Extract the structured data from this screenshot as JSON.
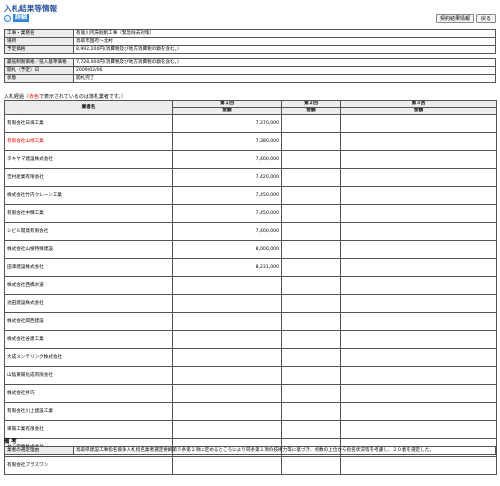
{
  "header": {
    "title": "入札結果等情報",
    "section_label": "詳細",
    "buttons": {
      "contract_result": "契約結果情報",
      "back": "戻る"
    }
  },
  "info": [
    {
      "label": "工事・業務名",
      "value": "有富川河床掘削工事（緊急除去対策）"
    },
    {
      "label": "場所",
      "value": "鳥取市国府～北村"
    },
    {
      "label": "予定価格",
      "value": "8,992,200円(消費税及び地方消費税の額を含む。)"
    },
    {
      "label": "最低制限価格／低入基準価格",
      "value": "7,728,000円(消費税及び地方消費税の額を含む。)"
    },
    {
      "label": "開札（予定）日",
      "value": "2009/02/06"
    },
    {
      "label": "状態",
      "value": "開札完了"
    }
  ],
  "bid_table": {
    "caption_prefix": "入札経過（",
    "caption_red": "赤色",
    "caption_suffix": "で表示されているのは落札業者です。）",
    "headers": {
      "company": "業者名",
      "round1": "第１回",
      "round2": "第２回",
      "round3": "第３回",
      "amount": "金額",
      "remarks": "摘要"
    },
    "rows": [
      {
        "company": "有限会社日海工業",
        "amount": "7,270,000",
        "remark": "失格（無効）　最低制限価格を下回ったため",
        "winner": false
      },
      {
        "company": "有限会社山崎工業",
        "amount": "7,380,000",
        "remark": "落札",
        "winner": true
      },
      {
        "company": "タキヤマ建設株式会社",
        "amount": "7,400,000",
        "remark": "",
        "winner": false
      },
      {
        "company": "吉村産業有限会社",
        "amount": "7,420,000",
        "remark": "",
        "winner": false
      },
      {
        "company": "株式会社竹内クレーン工業",
        "amount": "7,450,000",
        "remark": "",
        "winner": false
      },
      {
        "company": "有限会社中輝工業",
        "amount": "7,450,000",
        "remark": "",
        "winner": false
      },
      {
        "company": "シビル開発有限会社",
        "amount": "7,400,000",
        "remark": "",
        "winner": false
      },
      {
        "company": "株式会社山根特殊建設",
        "amount": "8,000,000",
        "remark": "",
        "winner": false
      },
      {
        "company": "田澤建設株式会社",
        "amount": "8,231,000",
        "remark": "",
        "winner": false
      },
      {
        "company": "株式会社西橋水道",
        "amount": "",
        "remark": "辞退",
        "winner": false
      },
      {
        "company": "池田建設株式会社",
        "amount": "",
        "remark": "欠席",
        "winner": false
      },
      {
        "company": "株式会社関西建設",
        "amount": "",
        "remark": "辞退",
        "winner": false
      },
      {
        "company": "株式会社谷建工業",
        "amount": "",
        "remark": "辞退",
        "winner": false
      },
      {
        "company": "大成メンテリング株式会社",
        "amount": "",
        "remark": "辞退",
        "winner": false
      },
      {
        "company": "山陰東陽化成有限会社",
        "amount": "",
        "remark": "辞退",
        "winner": false
      },
      {
        "company": "株式会社井巧",
        "amount": "",
        "remark": "辞退",
        "winner": false
      },
      {
        "company": "有限会社川上建設工業",
        "amount": "",
        "remark": "辞退",
        "winner": false
      },
      {
        "company": "東陽工業有限会社",
        "amount": "",
        "remark": "辞退",
        "winner": false
      },
      {
        "company": "サン興業株式会社",
        "amount": "",
        "remark": "辞退",
        "winner": false
      },
      {
        "company": "有限会社プラスワン",
        "amount": "",
        "remark": "辞退",
        "winner": false
      }
    ]
  },
  "notes": {
    "title": "備 考",
    "label": "業者の選定理由",
    "text": "鳥取県建設工事指名競争入札指名業者選定要綱第５条第２項に定めるところにより同条第１項の技術力等に基づき、点数の上位から指名状況等を考慮し、２０者を選定した。"
  }
}
